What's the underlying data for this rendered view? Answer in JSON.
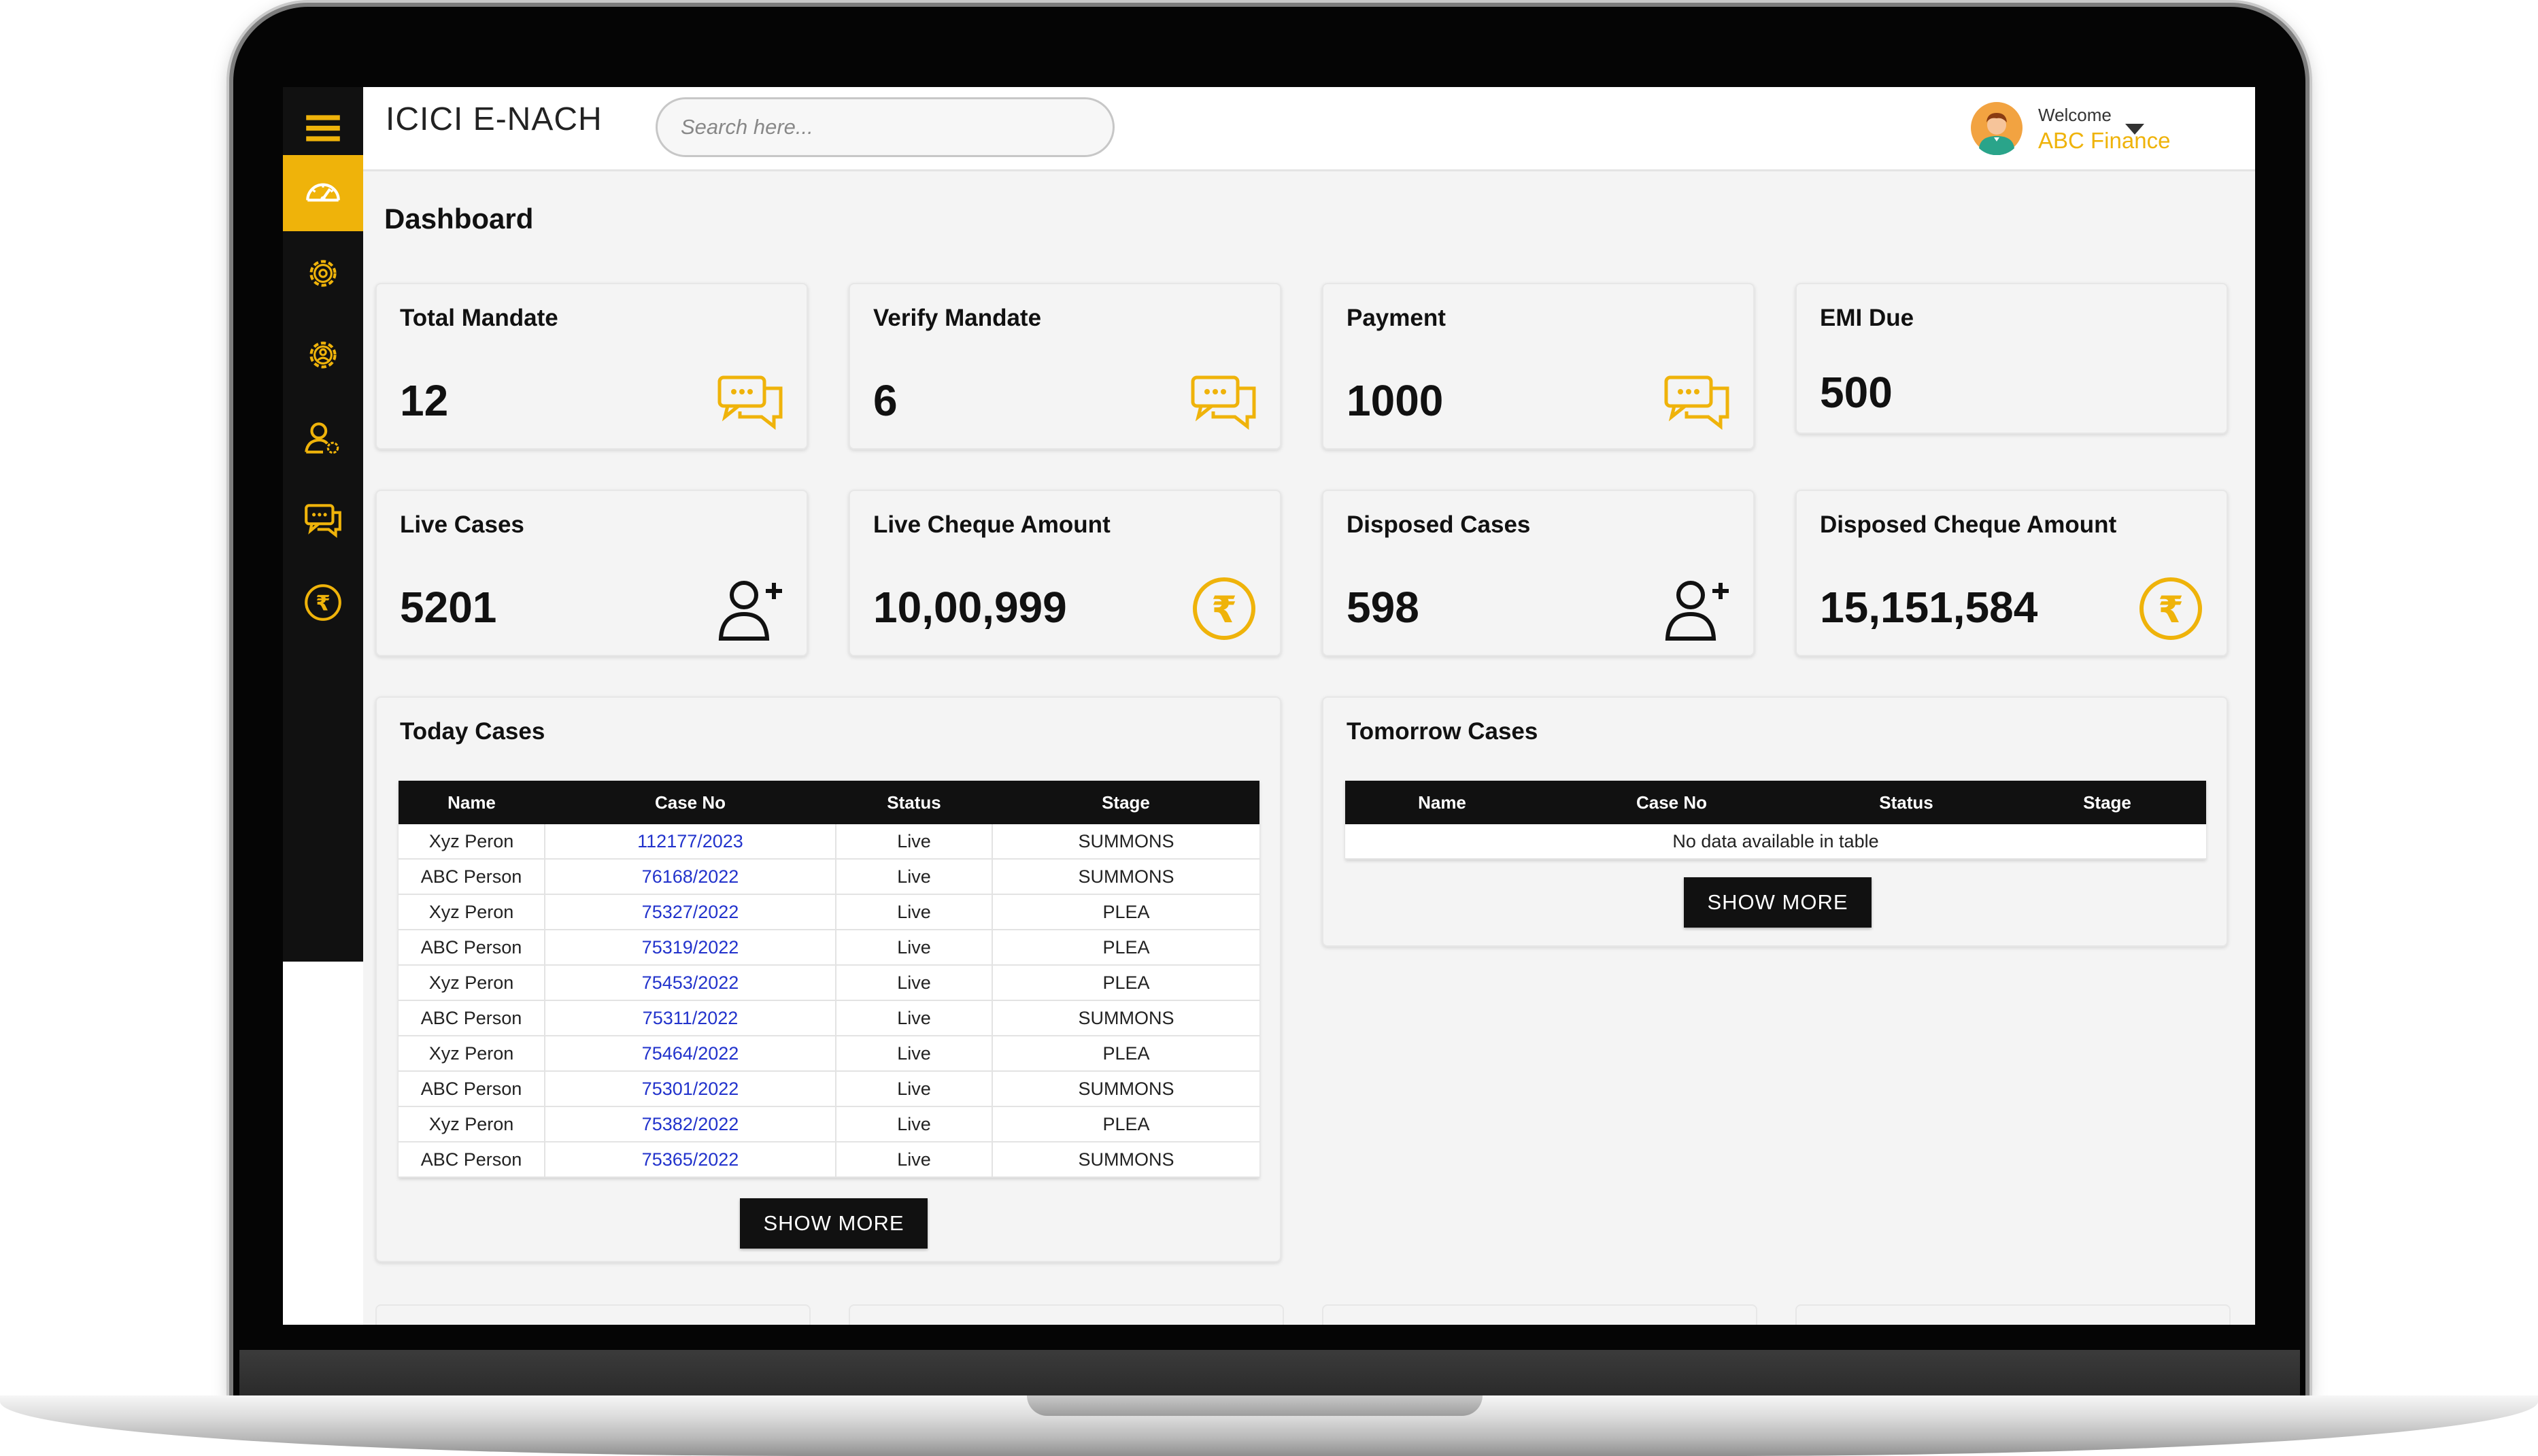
{
  "app": {
    "title": "ICICI E-NACH"
  },
  "search": {
    "placeholder": "Search here..."
  },
  "user": {
    "welcome": "Welcome",
    "name": "ABC Finance"
  },
  "page": {
    "title": "Dashboard"
  },
  "colors": {
    "accent": "#efb30a",
    "sidebar": "#111111",
    "link": "#2233cc"
  },
  "sidebar": {
    "items": [
      {
        "icon": "menu-icon"
      },
      {
        "icon": "dashboard-icon",
        "active": true
      },
      {
        "icon": "settings-icon"
      },
      {
        "icon": "settings-icon"
      },
      {
        "icon": "user-settings-icon"
      },
      {
        "icon": "chat-icon"
      },
      {
        "icon": "rupee-icon"
      }
    ]
  },
  "stats": [
    {
      "label": "Total Mandate",
      "value": "12",
      "icon": "chat-icon"
    },
    {
      "label": "Verify Mandate",
      "value": "6",
      "icon": "chat-icon"
    },
    {
      "label": "Payment",
      "value": "1000",
      "icon": "chat-icon"
    },
    {
      "label": "EMI Due",
      "value": "500",
      "icon": ""
    },
    {
      "label": "Live Cases",
      "value": "5201",
      "icon": "add-user-icon"
    },
    {
      "label": "Live Cheque Amount",
      "value": "10,00,999",
      "icon": "rupee-icon"
    },
    {
      "label": "Disposed Cases",
      "value": "598",
      "icon": "add-user-icon"
    },
    {
      "label": "Disposed Cheque Amount",
      "value": "15,151,584",
      "icon": "rupee-icon"
    }
  ],
  "today": {
    "title": "Today Cases",
    "columns": [
      "Name",
      "Case No",
      "Status",
      "Stage"
    ],
    "rows": [
      [
        "Xyz Peron",
        "112177/2023",
        "Live",
        "SUMMONS"
      ],
      [
        "ABC Person",
        "76168/2022",
        "Live",
        "SUMMONS"
      ],
      [
        "Xyz Peron",
        "75327/2022",
        "Live",
        "PLEA"
      ],
      [
        "ABC Person",
        "75319/2022",
        "Live",
        "PLEA"
      ],
      [
        "Xyz Peron",
        "75453/2022",
        "Live",
        "PLEA"
      ],
      [
        "ABC Person",
        "75311/2022",
        "Live",
        "SUMMONS"
      ],
      [
        "Xyz Peron",
        "75464/2022",
        "Live",
        "PLEA"
      ],
      [
        "ABC Person",
        "75301/2022",
        "Live",
        "SUMMONS"
      ],
      [
        "Xyz Peron",
        "75382/2022",
        "Live",
        "PLEA"
      ],
      [
        "ABC Person",
        "75365/2022",
        "Live",
        "SUMMONS"
      ]
    ],
    "button": "SHOW MORE"
  },
  "tomorrow": {
    "title": "Tomorrow Cases",
    "columns": [
      "Name",
      "Case No",
      "Status",
      "Stage"
    ],
    "empty": "No data available in table",
    "button": "SHOW MORE"
  }
}
